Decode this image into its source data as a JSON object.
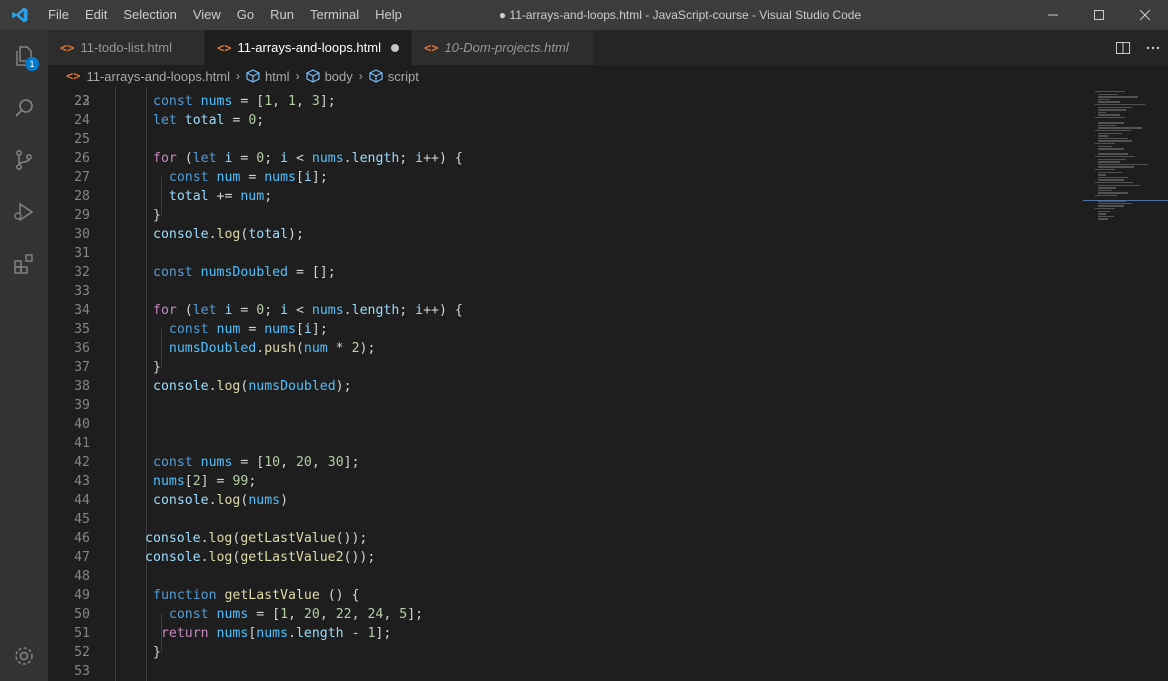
{
  "titlebar": {
    "menu": [
      "File",
      "Edit",
      "Selection",
      "View",
      "Go",
      "Run",
      "Terminal",
      "Help"
    ],
    "title": "● 11-arrays-and-loops.html - JavaScript-course - Visual Studio Code"
  },
  "activity": {
    "explorer_badge": "1"
  },
  "tabs": [
    {
      "label": "11-todo-list.html",
      "icon": "<>"
    },
    {
      "label": "11-arrays-and-loops.html",
      "icon": "<>"
    },
    {
      "label": "10-Dom-projects.html",
      "icon": "<>"
    }
  ],
  "breadcrumbs": {
    "file": "11-arrays-and-loops.html",
    "items": [
      "html",
      "body",
      "script"
    ]
  },
  "editor": {
    "first_line_partial": "22",
    "lines": [
      {
        "num": "23",
        "code": "const nums = [1, 1, 3];"
      },
      {
        "num": "24",
        "code": "let total = 0;"
      },
      {
        "num": "25",
        "code": ""
      },
      {
        "num": "26",
        "code": "for (let i = 0; i < nums.length; i++) {"
      },
      {
        "num": "27",
        "code": "  const num = nums[i];"
      },
      {
        "num": "28",
        "code": "  total += num;"
      },
      {
        "num": "29",
        "code": "}"
      },
      {
        "num": "30",
        "code": "console.log(total);"
      },
      {
        "num": "31",
        "code": ""
      },
      {
        "num": "32",
        "code": "const numsDoubled = [];"
      },
      {
        "num": "33",
        "code": ""
      },
      {
        "num": "34",
        "code": "for (let i = 0; i < nums.length; i++) {"
      },
      {
        "num": "35",
        "code": "  const num = nums[i];"
      },
      {
        "num": "36",
        "code": "  numsDoubled.push(num * 2);"
      },
      {
        "num": "37",
        "code": "}"
      },
      {
        "num": "38",
        "code": "console.log(numsDoubled);"
      },
      {
        "num": "39",
        "code": ""
      },
      {
        "num": "40",
        "code": ""
      },
      {
        "num": "41",
        "code": ""
      },
      {
        "num": "42",
        "code": "const nums = [10, 20, 30];"
      },
      {
        "num": "43",
        "code": "nums[2] = 99;"
      },
      {
        "num": "44",
        "code": "console.log(nums)"
      },
      {
        "num": "45",
        "code": ""
      },
      {
        "num": "46",
        "code": "console.log(getLastValue());"
      },
      {
        "num": "47",
        "code": "console.log(getLastValue2());"
      },
      {
        "num": "48",
        "code": ""
      },
      {
        "num": "49",
        "code": "function getLastValue () {"
      },
      {
        "num": "50",
        "code": "  const nums = [1, 20, 22, 24, 5];"
      },
      {
        "num": "51",
        "code": " return nums[nums.length - 1];"
      },
      {
        "num": "52",
        "code": "}"
      },
      {
        "num": "53",
        "code": ""
      }
    ]
  },
  "colors": {
    "keyword": "#569cd6",
    "control": "#c586c0",
    "variable": "#9cdcfe",
    "number": "#b5cea8",
    "function": "#dcdcaa",
    "accent": "#007acc"
  }
}
